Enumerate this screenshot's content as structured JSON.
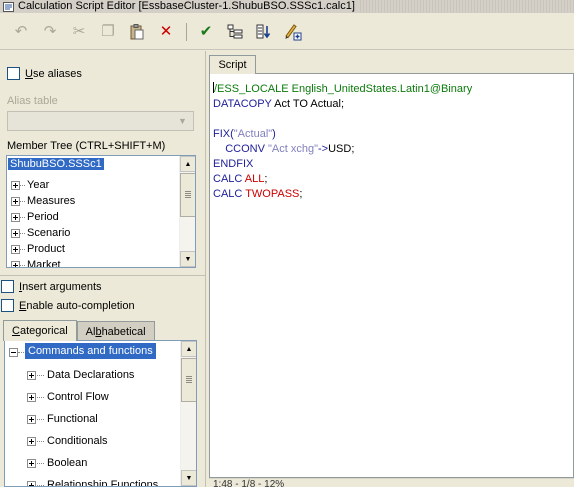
{
  "window": {
    "title": "Calculation Script Editor [EssbaseCluster-1.ShubuBSO.SSSc1.calc1]"
  },
  "toolbar": {
    "buttons": [
      {
        "name": "undo-button",
        "icon": "undo-icon",
        "glyph": "↶",
        "enabled": false
      },
      {
        "name": "redo-button",
        "icon": "redo-icon",
        "glyph": "↷",
        "enabled": false
      },
      {
        "name": "cut-button",
        "icon": "scissors-icon",
        "glyph": "✂",
        "enabled": false
      },
      {
        "name": "copy-button",
        "icon": "copy-icon",
        "glyph": "❐",
        "enabled": false
      },
      {
        "name": "paste-button",
        "icon": "paste-icon",
        "glyph": "📋",
        "enabled": true
      },
      {
        "name": "delete-button",
        "icon": "delete-x-icon",
        "glyph": "✕",
        "enabled": true,
        "color": "#cc0000"
      },
      {
        "name": "validate-button",
        "icon": "checkmark-icon",
        "glyph": "✔",
        "enabled": true,
        "color": "#1a7a1a"
      },
      {
        "name": "outline-button",
        "icon": "outline-tree-icon",
        "glyph": "⊟",
        "enabled": true
      },
      {
        "name": "execute-button",
        "icon": "execute-icon",
        "glyph": "⇊",
        "enabled": true
      },
      {
        "name": "insert-function-button",
        "icon": "pencil-plus-icon",
        "glyph": "✎",
        "enabled": true
      }
    ]
  },
  "left": {
    "use_aliases": {
      "label": "Use aliases",
      "checked": false
    },
    "alias_table": {
      "label": "Alias table",
      "value": ""
    },
    "member_tree": {
      "label": "Member Tree (CTRL+SHIFT+M)",
      "root": "ShubuBSO.SSSc1",
      "items": [
        "Year",
        "Measures",
        "Period",
        "Scenario",
        "Product",
        "Market"
      ]
    },
    "insert_arguments": {
      "label": "Insert arguments",
      "checked": false
    },
    "auto_completion": {
      "label": "Enable auto-completion",
      "checked": false
    },
    "tabs": [
      {
        "label": "Categorical",
        "active": true
      },
      {
        "label": "Alphabetical",
        "active": false
      }
    ],
    "commands_tree": {
      "root": "Commands and functions",
      "items": [
        "Data Declarations",
        "Control Flow",
        "Functional",
        "Conditionals",
        "Boolean",
        "Relationship Functions"
      ]
    }
  },
  "editor": {
    "tab_label": "Script",
    "status": "1:48 - 1/8 - 12%"
  },
  "colors": {
    "selection": "#316ac5",
    "keyword": "#1e1e99",
    "keyword_red": "#cc0000",
    "string": "#7f7fbf",
    "comment": "#0a7a0a"
  }
}
